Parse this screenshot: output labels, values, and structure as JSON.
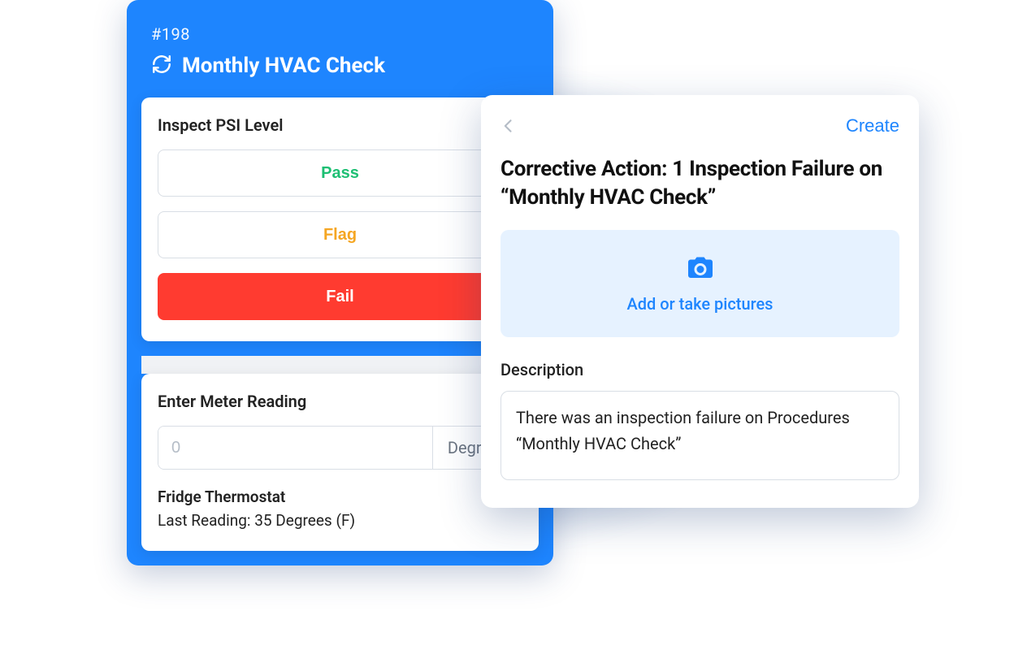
{
  "work_order": {
    "id_label": "#198",
    "title": "Monthly HVAC Check"
  },
  "inspect": {
    "title": "Inspect PSI Level",
    "pass_label": "Pass",
    "flag_label": "Flag",
    "fail_label": "Fail"
  },
  "meter": {
    "title": "Enter Meter Reading",
    "placeholder": "0",
    "unit": "Degrees",
    "device": "Fridge Thermostat",
    "last_reading": "Last Reading: 35 Degrees (F)"
  },
  "corrective": {
    "create_label": "Create",
    "title": "Corrective Action: 1 Inspection Failure on “Monthly HVAC Check”",
    "photo_label": "Add or take pictures",
    "desc_label": "Description",
    "desc_value": "There was an inspection failure on Procedures “Monthly HVAC Check”"
  }
}
